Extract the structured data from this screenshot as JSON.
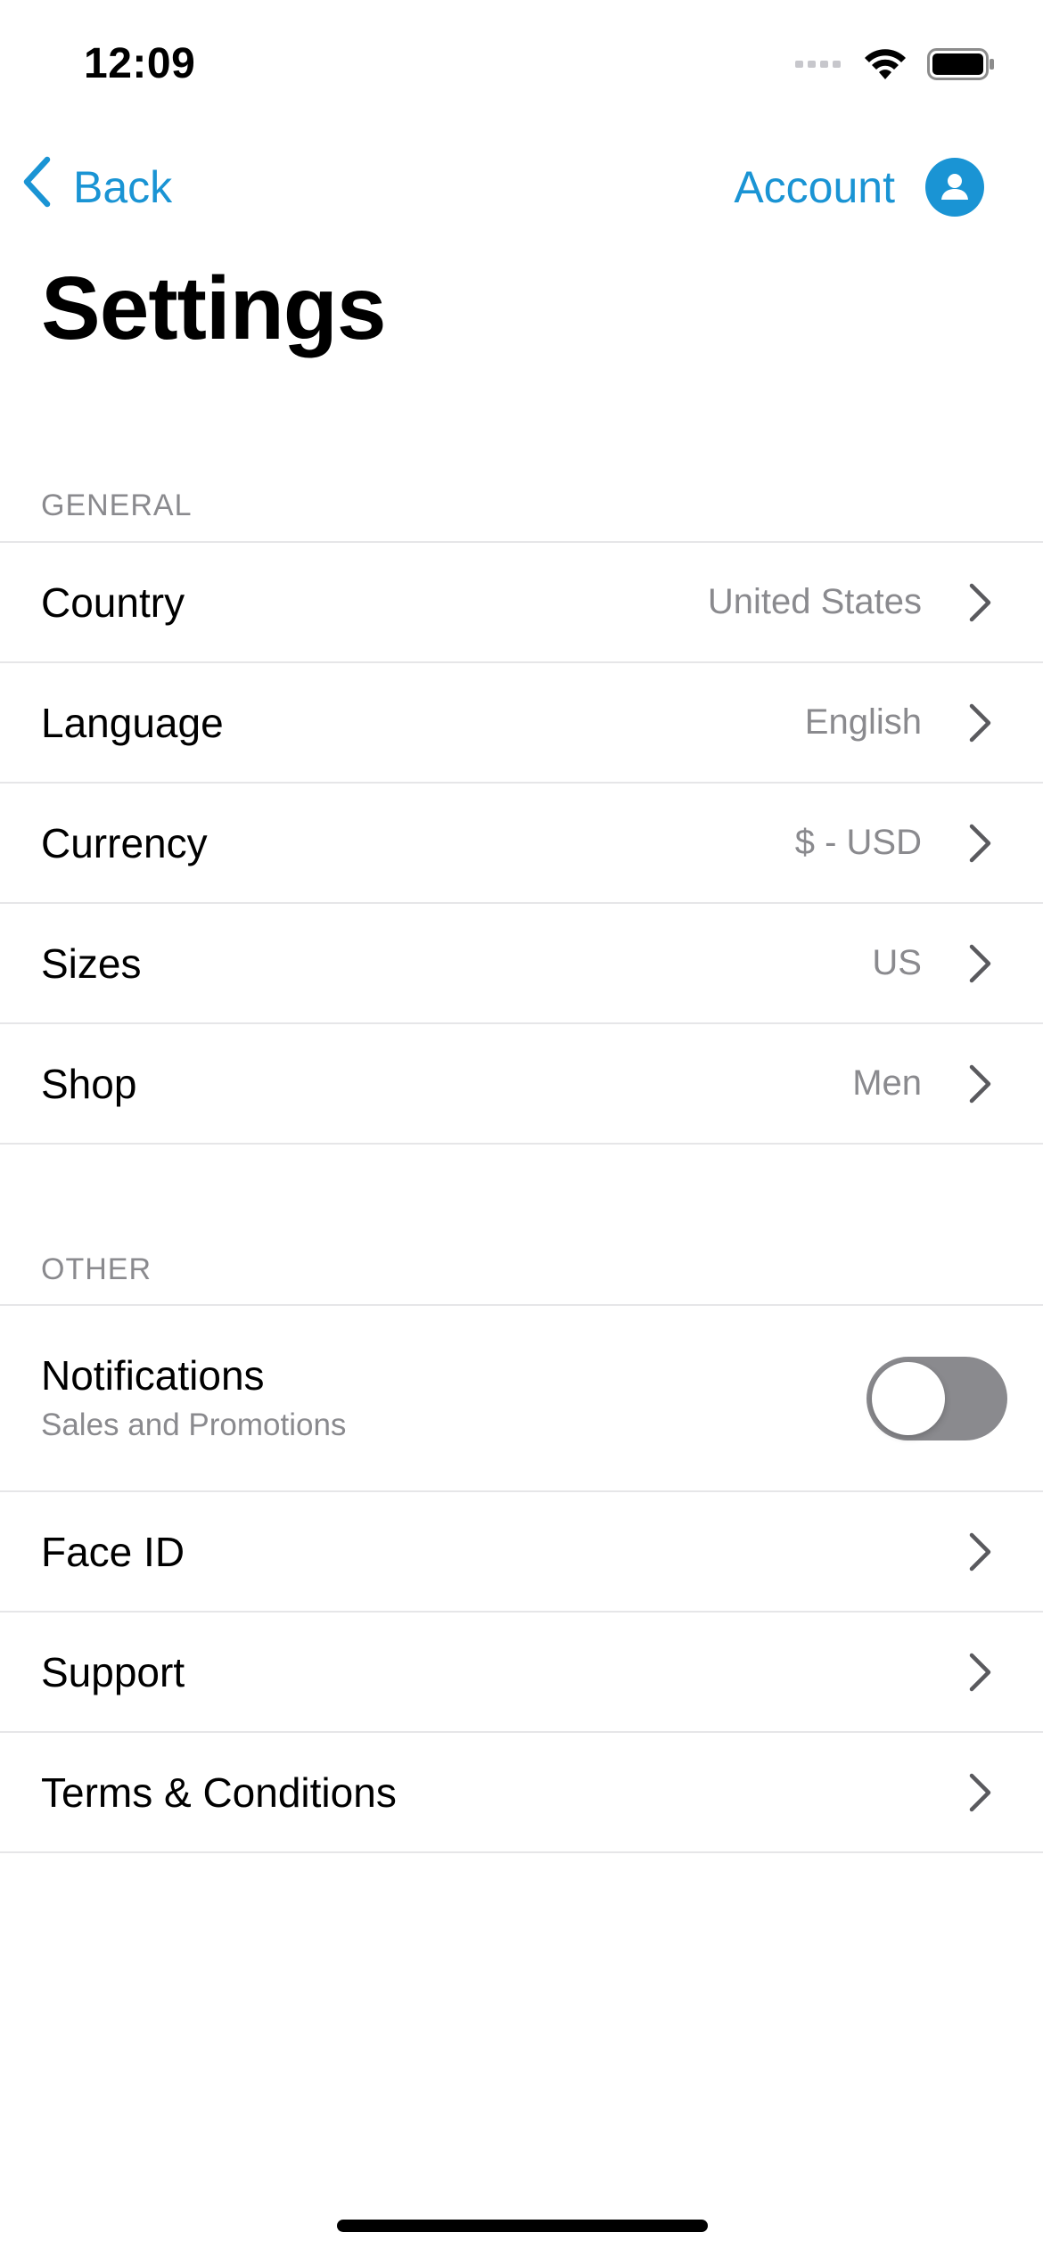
{
  "status_bar": {
    "time": "12:09",
    "icons": [
      "cellular-signal-icon",
      "wifi-icon",
      "battery-icon"
    ]
  },
  "nav": {
    "back_label": "Back",
    "account_label": "Account",
    "back_icon": "chevron-left-icon",
    "account_icon": "person-circle-icon"
  },
  "page": {
    "title": "Settings"
  },
  "sections": {
    "general": {
      "header": "GENERAL",
      "rows": [
        {
          "label": "Country",
          "value": "United States"
        },
        {
          "label": "Language",
          "value": "English"
        },
        {
          "label": "Currency",
          "value": "$ - USD"
        },
        {
          "label": "Sizes",
          "value": "US"
        },
        {
          "label": "Shop",
          "value": "Men"
        }
      ]
    },
    "other": {
      "header": "OTHER",
      "notifications": {
        "label": "Notifications",
        "sublabel": "Sales and Promotions",
        "enabled": false
      },
      "rows": [
        {
          "label": "Face ID"
        },
        {
          "label": "Support"
        },
        {
          "label": "Terms & Conditions"
        }
      ]
    }
  },
  "colors": {
    "accent": "#1a94d4",
    "secondary_text": "#8a8a8e",
    "separator": "#e6e6e8",
    "toggle_off": "#8a8a8e"
  }
}
